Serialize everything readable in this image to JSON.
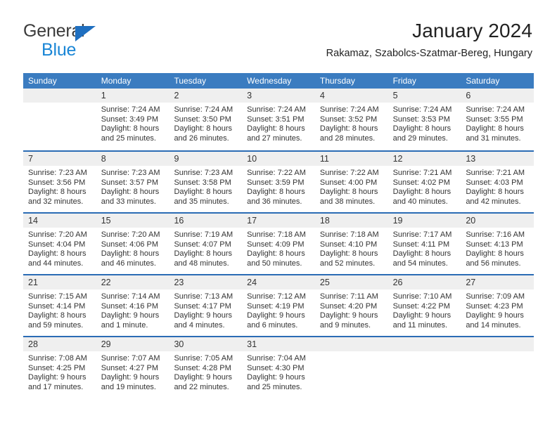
{
  "brand": {
    "name_top": "General",
    "name_bottom": "Blue",
    "accent_blue": "#1a86d6",
    "triangle_blue": "#1f6fc0",
    "top_text_color": "#3b3b3b"
  },
  "header": {
    "title": "January 2024",
    "location": "Rakamaz, Szabolcs-Szatmar-Bereg, Hungary"
  },
  "calendar": {
    "header_bg": "#3b7cc0",
    "header_text_color": "#ffffff",
    "week_separator_color": "#2b6cb5",
    "day_band_bg": "#efefef",
    "weekdays": [
      "Sunday",
      "Monday",
      "Tuesday",
      "Wednesday",
      "Thursday",
      "Friday",
      "Saturday"
    ],
    "weeks": [
      [
        {
          "day": "",
          "sunrise": "",
          "sunset": "",
          "daylight_line1": "",
          "daylight_line2": ""
        },
        {
          "day": "1",
          "sunrise": "Sunrise: 7:24 AM",
          "sunset": "Sunset: 3:49 PM",
          "daylight_line1": "Daylight: 8 hours",
          "daylight_line2": "and 25 minutes."
        },
        {
          "day": "2",
          "sunrise": "Sunrise: 7:24 AM",
          "sunset": "Sunset: 3:50 PM",
          "daylight_line1": "Daylight: 8 hours",
          "daylight_line2": "and 26 minutes."
        },
        {
          "day": "3",
          "sunrise": "Sunrise: 7:24 AM",
          "sunset": "Sunset: 3:51 PM",
          "daylight_line1": "Daylight: 8 hours",
          "daylight_line2": "and 27 minutes."
        },
        {
          "day": "4",
          "sunrise": "Sunrise: 7:24 AM",
          "sunset": "Sunset: 3:52 PM",
          "daylight_line1": "Daylight: 8 hours",
          "daylight_line2": "and 28 minutes."
        },
        {
          "day": "5",
          "sunrise": "Sunrise: 7:24 AM",
          "sunset": "Sunset: 3:53 PM",
          "daylight_line1": "Daylight: 8 hours",
          "daylight_line2": "and 29 minutes."
        },
        {
          "day": "6",
          "sunrise": "Sunrise: 7:24 AM",
          "sunset": "Sunset: 3:55 PM",
          "daylight_line1": "Daylight: 8 hours",
          "daylight_line2": "and 31 minutes."
        }
      ],
      [
        {
          "day": "7",
          "sunrise": "Sunrise: 7:23 AM",
          "sunset": "Sunset: 3:56 PM",
          "daylight_line1": "Daylight: 8 hours",
          "daylight_line2": "and 32 minutes."
        },
        {
          "day": "8",
          "sunrise": "Sunrise: 7:23 AM",
          "sunset": "Sunset: 3:57 PM",
          "daylight_line1": "Daylight: 8 hours",
          "daylight_line2": "and 33 minutes."
        },
        {
          "day": "9",
          "sunrise": "Sunrise: 7:23 AM",
          "sunset": "Sunset: 3:58 PM",
          "daylight_line1": "Daylight: 8 hours",
          "daylight_line2": "and 35 minutes."
        },
        {
          "day": "10",
          "sunrise": "Sunrise: 7:22 AM",
          "sunset": "Sunset: 3:59 PM",
          "daylight_line1": "Daylight: 8 hours",
          "daylight_line2": "and 36 minutes."
        },
        {
          "day": "11",
          "sunrise": "Sunrise: 7:22 AM",
          "sunset": "Sunset: 4:00 PM",
          "daylight_line1": "Daylight: 8 hours",
          "daylight_line2": "and 38 minutes."
        },
        {
          "day": "12",
          "sunrise": "Sunrise: 7:21 AM",
          "sunset": "Sunset: 4:02 PM",
          "daylight_line1": "Daylight: 8 hours",
          "daylight_line2": "and 40 minutes."
        },
        {
          "day": "13",
          "sunrise": "Sunrise: 7:21 AM",
          "sunset": "Sunset: 4:03 PM",
          "daylight_line1": "Daylight: 8 hours",
          "daylight_line2": "and 42 minutes."
        }
      ],
      [
        {
          "day": "14",
          "sunrise": "Sunrise: 7:20 AM",
          "sunset": "Sunset: 4:04 PM",
          "daylight_line1": "Daylight: 8 hours",
          "daylight_line2": "and 44 minutes."
        },
        {
          "day": "15",
          "sunrise": "Sunrise: 7:20 AM",
          "sunset": "Sunset: 4:06 PM",
          "daylight_line1": "Daylight: 8 hours",
          "daylight_line2": "and 46 minutes."
        },
        {
          "day": "16",
          "sunrise": "Sunrise: 7:19 AM",
          "sunset": "Sunset: 4:07 PM",
          "daylight_line1": "Daylight: 8 hours",
          "daylight_line2": "and 48 minutes."
        },
        {
          "day": "17",
          "sunrise": "Sunrise: 7:18 AM",
          "sunset": "Sunset: 4:09 PM",
          "daylight_line1": "Daylight: 8 hours",
          "daylight_line2": "and 50 minutes."
        },
        {
          "day": "18",
          "sunrise": "Sunrise: 7:18 AM",
          "sunset": "Sunset: 4:10 PM",
          "daylight_line1": "Daylight: 8 hours",
          "daylight_line2": "and 52 minutes."
        },
        {
          "day": "19",
          "sunrise": "Sunrise: 7:17 AM",
          "sunset": "Sunset: 4:11 PM",
          "daylight_line1": "Daylight: 8 hours",
          "daylight_line2": "and 54 minutes."
        },
        {
          "day": "20",
          "sunrise": "Sunrise: 7:16 AM",
          "sunset": "Sunset: 4:13 PM",
          "daylight_line1": "Daylight: 8 hours",
          "daylight_line2": "and 56 minutes."
        }
      ],
      [
        {
          "day": "21",
          "sunrise": "Sunrise: 7:15 AM",
          "sunset": "Sunset: 4:14 PM",
          "daylight_line1": "Daylight: 8 hours",
          "daylight_line2": "and 59 minutes."
        },
        {
          "day": "22",
          "sunrise": "Sunrise: 7:14 AM",
          "sunset": "Sunset: 4:16 PM",
          "daylight_line1": "Daylight: 9 hours",
          "daylight_line2": "and 1 minute."
        },
        {
          "day": "23",
          "sunrise": "Sunrise: 7:13 AM",
          "sunset": "Sunset: 4:17 PM",
          "daylight_line1": "Daylight: 9 hours",
          "daylight_line2": "and 4 minutes."
        },
        {
          "day": "24",
          "sunrise": "Sunrise: 7:12 AM",
          "sunset": "Sunset: 4:19 PM",
          "daylight_line1": "Daylight: 9 hours",
          "daylight_line2": "and 6 minutes."
        },
        {
          "day": "25",
          "sunrise": "Sunrise: 7:11 AM",
          "sunset": "Sunset: 4:20 PM",
          "daylight_line1": "Daylight: 9 hours",
          "daylight_line2": "and 9 minutes."
        },
        {
          "day": "26",
          "sunrise": "Sunrise: 7:10 AM",
          "sunset": "Sunset: 4:22 PM",
          "daylight_line1": "Daylight: 9 hours",
          "daylight_line2": "and 11 minutes."
        },
        {
          "day": "27",
          "sunrise": "Sunrise: 7:09 AM",
          "sunset": "Sunset: 4:23 PM",
          "daylight_line1": "Daylight: 9 hours",
          "daylight_line2": "and 14 minutes."
        }
      ],
      [
        {
          "day": "28",
          "sunrise": "Sunrise: 7:08 AM",
          "sunset": "Sunset: 4:25 PM",
          "daylight_line1": "Daylight: 9 hours",
          "daylight_line2": "and 17 minutes."
        },
        {
          "day": "29",
          "sunrise": "Sunrise: 7:07 AM",
          "sunset": "Sunset: 4:27 PM",
          "daylight_line1": "Daylight: 9 hours",
          "daylight_line2": "and 19 minutes."
        },
        {
          "day": "30",
          "sunrise": "Sunrise: 7:05 AM",
          "sunset": "Sunset: 4:28 PM",
          "daylight_line1": "Daylight: 9 hours",
          "daylight_line2": "and 22 minutes."
        },
        {
          "day": "31",
          "sunrise": "Sunrise: 7:04 AM",
          "sunset": "Sunset: 4:30 PM",
          "daylight_line1": "Daylight: 9 hours",
          "daylight_line2": "and 25 minutes."
        },
        {
          "day": "",
          "sunrise": "",
          "sunset": "",
          "daylight_line1": "",
          "daylight_line2": ""
        },
        {
          "day": "",
          "sunrise": "",
          "sunset": "",
          "daylight_line1": "",
          "daylight_line2": ""
        },
        {
          "day": "",
          "sunrise": "",
          "sunset": "",
          "daylight_line1": "",
          "daylight_line2": ""
        }
      ]
    ]
  }
}
